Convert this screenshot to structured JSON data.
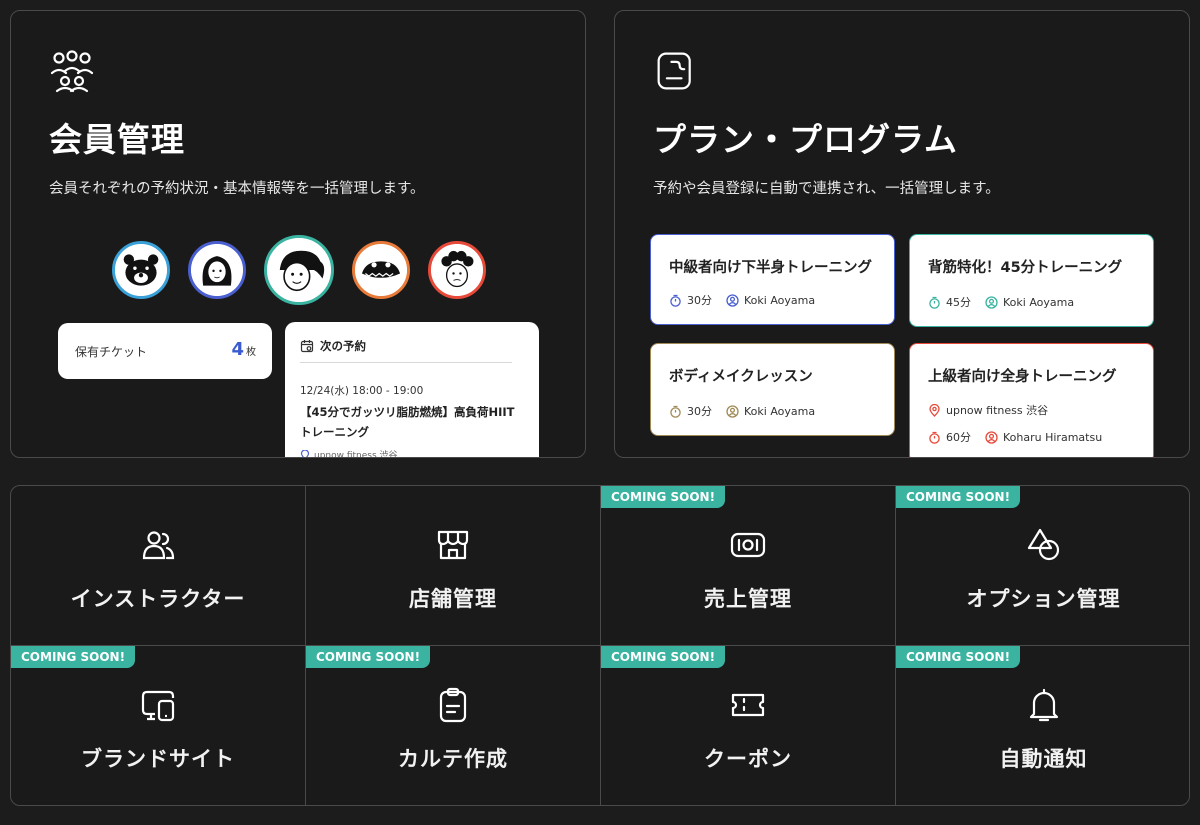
{
  "member_panel": {
    "title": "会員管理",
    "description": "会員それぞれの予約状況・基本情報等を一括管理します。",
    "avatars": [
      {
        "icon": "bear-avatar",
        "ring": "#3aa0d8"
      },
      {
        "icon": "woman-avatar",
        "ring": "#4a5fd0"
      },
      {
        "icon": "ponytail-avatar",
        "ring": "#3ab3a1"
      },
      {
        "icon": "crocodile-avatar",
        "ring": "#e87b3a"
      },
      {
        "icon": "curly-hair-avatar",
        "ring": "#e84a3a"
      }
    ],
    "ticket": {
      "label": "保有チケット",
      "count": "4",
      "unit": "枚"
    },
    "next_reservation": {
      "heading": "次の予約",
      "datetime": "12/24(水) 18:00 - 19:00",
      "program": "【45分でガッツリ脂肪燃焼】高負荷HIITトレーニング",
      "location": "upnow fitness 渋谷"
    }
  },
  "program_panel": {
    "title": "プラン・プログラム",
    "description": "予約や会員登録に自動で連携され、一括管理します。",
    "cards": [
      {
        "name": "中級者向け下半身トレーニング",
        "duration": "30分",
        "instructor": "Koki Aoyama",
        "color": "#4a5fd0"
      },
      {
        "name": "背筋特化！45分トレーニング",
        "duration": "45分",
        "instructor": "Koki Aoyama",
        "color": "#3ab3a1"
      },
      {
        "name": "ボディメイクレッスン",
        "duration": "30分",
        "instructor": "Koki Aoyama",
        "color": "#a08a55"
      },
      {
        "name": "上級者向け全身トレーニング",
        "location": "upnow fitness 渋谷",
        "duration": "60分",
        "instructor": "Koharu Hiramatsu",
        "color": "#e84a3a"
      }
    ]
  },
  "features": {
    "badge_text": "COMING SOON!",
    "items": [
      {
        "label": "インストラクター",
        "icon": "instructor-icon",
        "coming_soon": false
      },
      {
        "label": "店舗管理",
        "icon": "store-icon",
        "coming_soon": false
      },
      {
        "label": "売上管理",
        "icon": "sales-icon",
        "coming_soon": true
      },
      {
        "label": "オプション管理",
        "icon": "options-icon",
        "coming_soon": true
      },
      {
        "label": "ブランドサイト",
        "icon": "brand-site-icon",
        "coming_soon": true
      },
      {
        "label": "カルテ作成",
        "icon": "chart-record-icon",
        "coming_soon": true
      },
      {
        "label": "クーポン",
        "icon": "coupon-icon",
        "coming_soon": true
      },
      {
        "label": "自動通知",
        "icon": "bell-icon",
        "coming_soon": true
      }
    ]
  }
}
